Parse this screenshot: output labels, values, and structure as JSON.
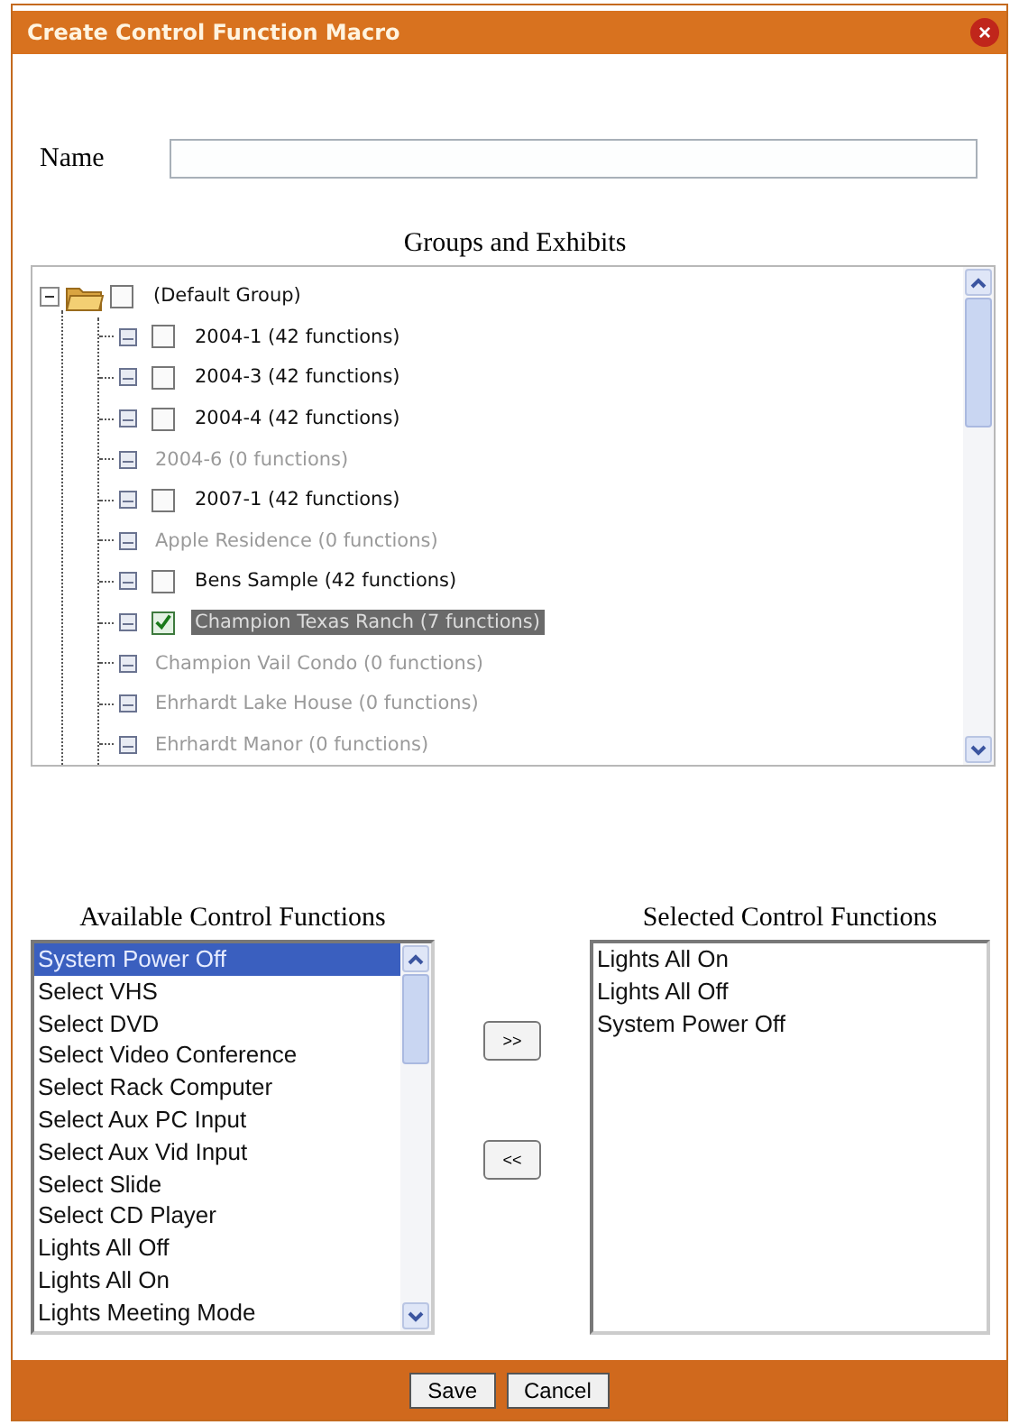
{
  "window": {
    "title": "Create Control Function Macro",
    "close_icon": "×"
  },
  "name_field": {
    "label": "Name"
  },
  "groups": {
    "heading": "Groups and Exhibits",
    "root": {
      "label": "(Default Group)",
      "expanded": true,
      "checked": false,
      "selected": false,
      "children": [
        {
          "label": "2004-1 (42 functions)",
          "kind": "checkbox",
          "checked": false,
          "disabled": false,
          "selected": false
        },
        {
          "label": "2004-3 (42 functions)",
          "kind": "checkbox",
          "checked": false,
          "disabled": false,
          "selected": false
        },
        {
          "label": "2004-4 (42 functions)",
          "kind": "checkbox",
          "checked": false,
          "disabled": false,
          "selected": false
        },
        {
          "label": "2004-6 (0 functions)",
          "kind": "plain",
          "disabled": true,
          "selected": false
        },
        {
          "label": "2007-1 (42 functions)",
          "kind": "checkbox",
          "checked": false,
          "disabled": false,
          "selected": false
        },
        {
          "label": "Apple Residence (0 functions)",
          "kind": "plain",
          "disabled": true,
          "selected": false
        },
        {
          "label": "Bens Sample (42 functions)",
          "kind": "checkbox",
          "checked": false,
          "disabled": false,
          "selected": false
        },
        {
          "label": "Champion Texas Ranch (7 functions)",
          "kind": "checkbox",
          "checked": true,
          "disabled": false,
          "selected": true
        },
        {
          "label": "Champion Vail Condo (0 functions)",
          "kind": "plain",
          "disabled": true,
          "selected": false
        },
        {
          "label": "Ehrhardt Lake House (0 functions)",
          "kind": "plain",
          "disabled": true,
          "selected": false
        },
        {
          "label": "Ehrhardt Manor (0 functions)",
          "kind": "plain",
          "disabled": true,
          "selected": false
        }
      ]
    }
  },
  "available": {
    "heading": "Available Control Functions",
    "items": [
      {
        "label": "System Power Off",
        "selected": true
      },
      {
        "label": "Select VHS",
        "selected": false
      },
      {
        "label": "Select DVD",
        "selected": false
      },
      {
        "label": "Select Video Conference",
        "selected": false
      },
      {
        "label": "Select Rack Computer",
        "selected": false
      },
      {
        "label": "Select Aux PC Input",
        "selected": false
      },
      {
        "label": "Select Aux Vid Input",
        "selected": false
      },
      {
        "label": "Select Slide",
        "selected": false
      },
      {
        "label": "Select CD Player",
        "selected": false
      },
      {
        "label": "Lights All Off",
        "selected": false
      },
      {
        "label": "Lights All On",
        "selected": false
      },
      {
        "label": "Lights Meeting Mode",
        "selected": false
      }
    ]
  },
  "move_buttons": [
    ">>",
    "<<"
  ],
  "selected_functions": {
    "heading": "Selected Control Functions",
    "items": [
      {
        "label": "Lights All On",
        "selected": false
      },
      {
        "label": "Lights All Off",
        "selected": false
      },
      {
        "label": "System Power Off",
        "selected": false
      }
    ]
  },
  "buttons": [
    "Save",
    "Cancel"
  ]
}
